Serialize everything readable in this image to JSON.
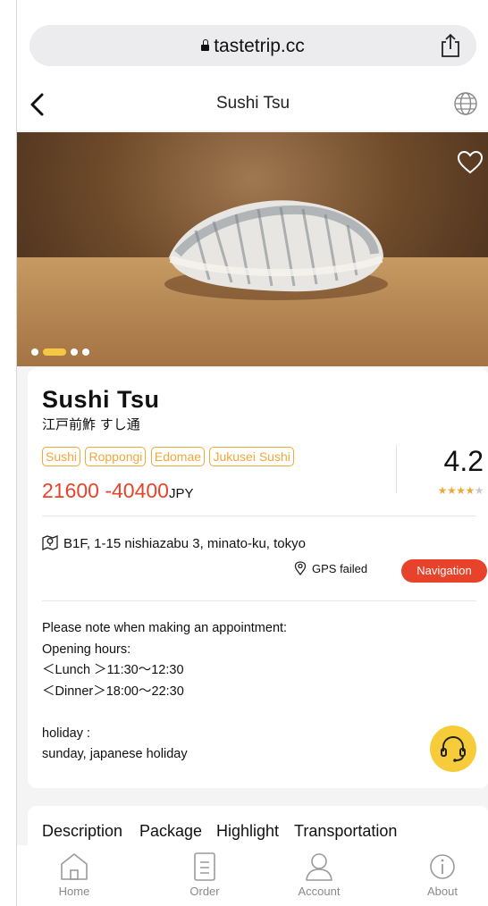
{
  "browser": {
    "url": "tastetrip.cc"
  },
  "header": {
    "title": "Sushi Tsu"
  },
  "hero": {
    "slide_count": 3,
    "active_slide": 1
  },
  "restaurant": {
    "name": "Sushi Tsu",
    "native_name": "江戸前鮓 すし通",
    "tags": [
      "Sushi",
      "Roppongi",
      "Edomae",
      "Jukusei Sushi"
    ],
    "price_range": "21600 -40400",
    "currency": "JPY",
    "rating": "4.2",
    "stars_filled": 4,
    "stars_total": 5,
    "address": "B1F, 1-15 nishiazabu 3, minato-ku, tokyo",
    "gps_status": "GPS failed",
    "navigation_label": "Navigation",
    "info_lines": [
      "Please note when making an appointment:",
      "Opening hours:",
      "＜Lunch ＞11:30〜12:30",
      "＜Dinner＞18:00〜22:30",
      "",
      "holiday :",
      "sunday, japanese holiday"
    ]
  },
  "tabs": [
    "Description",
    "Package",
    "Highlight",
    "Transportation"
  ],
  "active_tab": "Description",
  "bottom_nav": [
    {
      "label": "Home",
      "icon": "home-icon"
    },
    {
      "label": "Order",
      "icon": "order-icon"
    },
    {
      "label": "Account",
      "icon": "account-icon"
    },
    {
      "label": "About",
      "icon": "about-icon"
    }
  ],
  "colors": {
    "accent_red": "#e8432a",
    "accent_yellow": "#f7cc3a",
    "tag_orange": "#f0a83c"
  }
}
